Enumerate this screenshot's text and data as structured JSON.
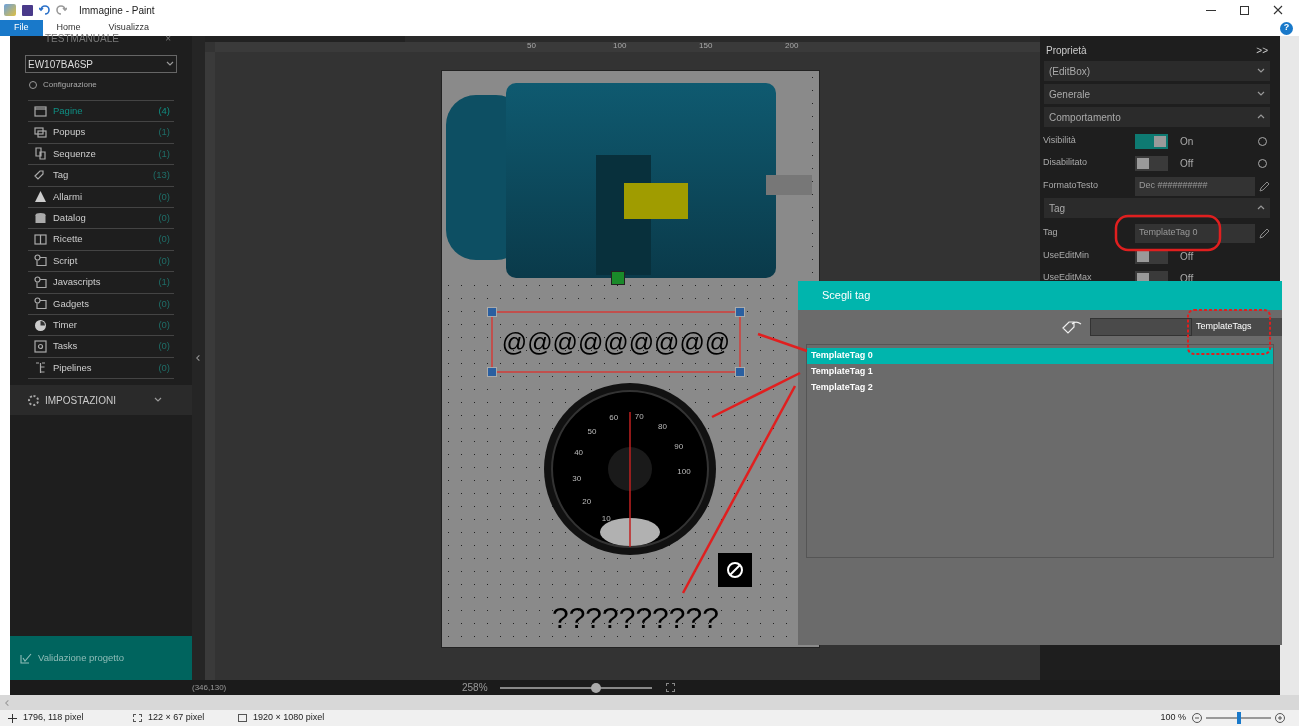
{
  "window": {
    "title": "Immagine - Paint",
    "help": "?"
  },
  "ribbon_tabs": [
    {
      "label": "File",
      "selected": true
    },
    {
      "label": "Home",
      "selected": false
    },
    {
      "label": "Visualizza",
      "selected": false
    }
  ],
  "sidebar": {
    "title": "TESTMANUALE",
    "close": "×",
    "device": "EW107BA6SP",
    "config": "Configurazione",
    "items": [
      {
        "label": "Pagine",
        "count": "(4)",
        "selected": true
      },
      {
        "label": "Popups",
        "count": "(1)",
        "selected": false
      },
      {
        "label": "Sequenze",
        "count": "(1)",
        "selected": false
      },
      {
        "label": "Tag",
        "count": "(13)",
        "selected": false
      },
      {
        "label": "Allarmi",
        "count": "(0)",
        "selected": false
      },
      {
        "label": "Datalog",
        "count": "(0)",
        "selected": false
      },
      {
        "label": "Ricette",
        "count": "(0)",
        "selected": false
      },
      {
        "label": "Script",
        "count": "(0)",
        "selected": false
      },
      {
        "label": "Javascripts",
        "count": "(1)",
        "selected": false
      },
      {
        "label": "Gadgets",
        "count": "(0)",
        "selected": false
      },
      {
        "label": "Timer",
        "count": "(0)",
        "selected": false
      },
      {
        "label": "Tasks",
        "count": "(0)",
        "selected": false
      },
      {
        "label": "Pipelines",
        "count": "(0)",
        "selected": false
      }
    ],
    "settings": "IMPOSTAZIONI",
    "validation": "Validazione progetto"
  },
  "ruler": {
    "labels": [
      "50",
      "100",
      "150",
      "200"
    ]
  },
  "canvas": {
    "editbox_text": "@@@@@@@@@",
    "gauge_labels": [
      "10",
      "20",
      "30",
      "40",
      "50",
      "60",
      "70",
      "80",
      "90",
      "100"
    ],
    "question_text": "??????????"
  },
  "properties": {
    "title": "Proprietà",
    "collapse": ">>",
    "rows": [
      {
        "kind": "section",
        "label": "(EditBox)",
        "expanded": false
      },
      {
        "kind": "section",
        "label": "Generale",
        "expanded": false
      },
      {
        "kind": "section",
        "label": "Comportamento",
        "expanded": true
      },
      {
        "kind": "toggle",
        "label": "Visibilità",
        "on": true,
        "value": "On"
      },
      {
        "kind": "toggle",
        "label": "Disabilitato",
        "on": false,
        "value": "Off"
      },
      {
        "kind": "field",
        "label": "FormatoTesto",
        "value": "Dec ##########"
      },
      {
        "kind": "section",
        "label": "Tag",
        "expanded": true
      },
      {
        "kind": "field",
        "label": "Tag",
        "value": "TemplateTag 0"
      },
      {
        "kind": "toggle",
        "label": "UseEditMin",
        "on": false,
        "value": "Off"
      },
      {
        "kind": "toggle",
        "label": "UseEditMax",
        "on": false,
        "value": "Off"
      }
    ]
  },
  "dialog": {
    "title": "Scegli tag",
    "group": "TemplateTags",
    "tags": [
      {
        "label": "TemplateTag 0",
        "selected": true
      },
      {
        "label": "TemplateTag 1",
        "selected": false
      },
      {
        "label": "TemplateTag 2",
        "selected": false
      }
    ]
  },
  "app_status": {
    "coords": "(346,130)",
    "zoom": "258%",
    "level": 0.63
  },
  "status_bar": {
    "cursor": "1796, 118 pixel",
    "selection": "122 × 67 pixel",
    "size": "1920 × 1080 pixel",
    "zoom": "100 %",
    "level": 0.5
  }
}
